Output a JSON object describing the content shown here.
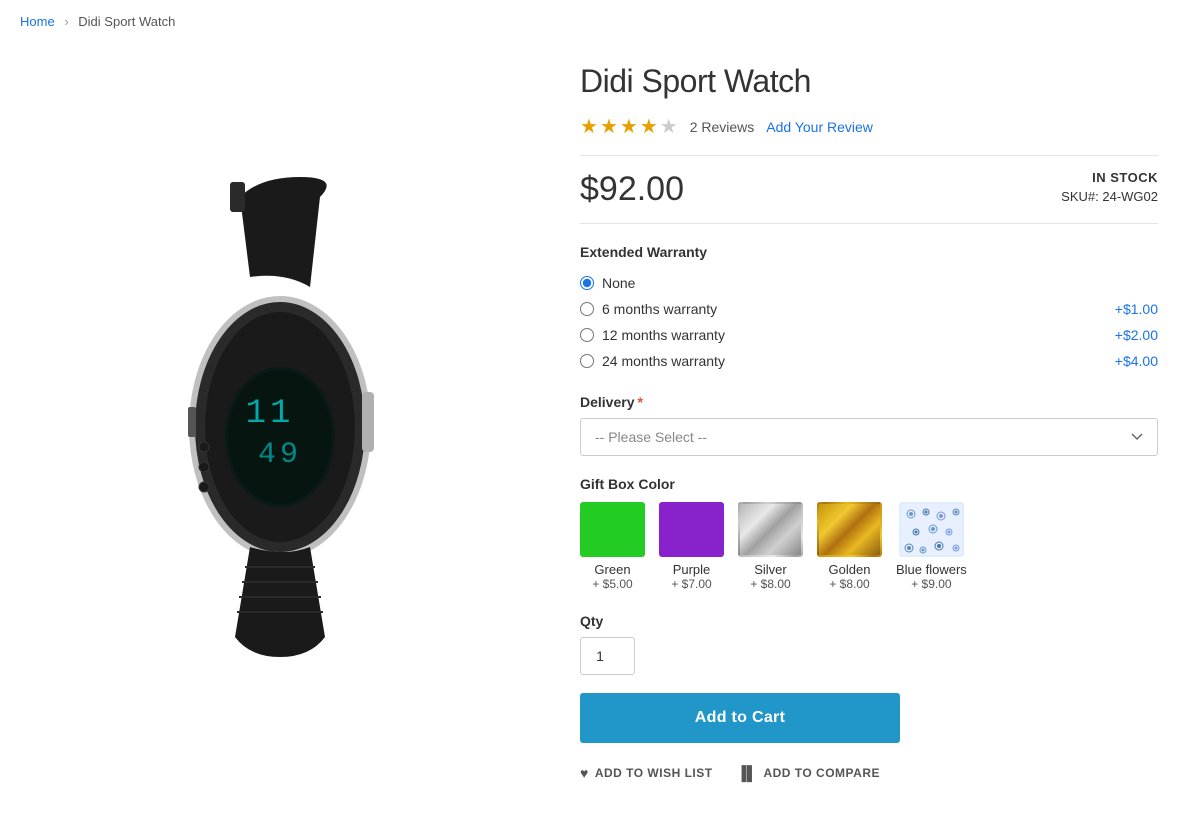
{
  "breadcrumb": {
    "home_label": "Home",
    "product_label": "Didi Sport Watch"
  },
  "product": {
    "title": "Didi Sport Watch",
    "price": "$92.00",
    "stock_status": "IN STOCK",
    "sku_label": "SKU#:",
    "sku_value": "24-WG02",
    "rating": {
      "filled_stars": 4,
      "empty_stars": 1,
      "review_count": "2",
      "reviews_label": "Reviews",
      "add_review_label": "Add Your Review"
    },
    "extended_warranty": {
      "section_title": "Extended Warranty",
      "options": [
        {
          "label": "None",
          "price": "",
          "checked": true
        },
        {
          "label": "6 months warranty",
          "price": "+$1.00",
          "checked": false
        },
        {
          "label": "12 months warranty",
          "price": "+$2.00",
          "checked": false
        },
        {
          "label": "24 months warranty",
          "price": "+$4.00",
          "checked": false
        }
      ]
    },
    "delivery": {
      "section_title": "Delivery",
      "required": true,
      "placeholder": "-- Please Select --"
    },
    "gift_box": {
      "section_title": "Gift Box Color",
      "options": [
        {
          "name": "Green",
          "price": "+ $5.00",
          "color": "#22cc22",
          "type": "solid"
        },
        {
          "name": "Purple",
          "price": "+ $7.00",
          "color": "#8822cc",
          "type": "solid"
        },
        {
          "name": "Silver",
          "price": "+ $8.00",
          "color": "",
          "type": "silver"
        },
        {
          "name": "Golden",
          "price": "+ $8.00",
          "color": "",
          "type": "golden"
        },
        {
          "name": "Blue flowers",
          "price": "+ $9.00",
          "color": "",
          "type": "blue-flowers"
        }
      ]
    },
    "qty": {
      "label": "Qty",
      "value": "1"
    },
    "add_to_cart_label": "Add to Cart",
    "wishlist_label": "ADD TO WISH LIST",
    "compare_label": "ADD TO COMPARE"
  }
}
